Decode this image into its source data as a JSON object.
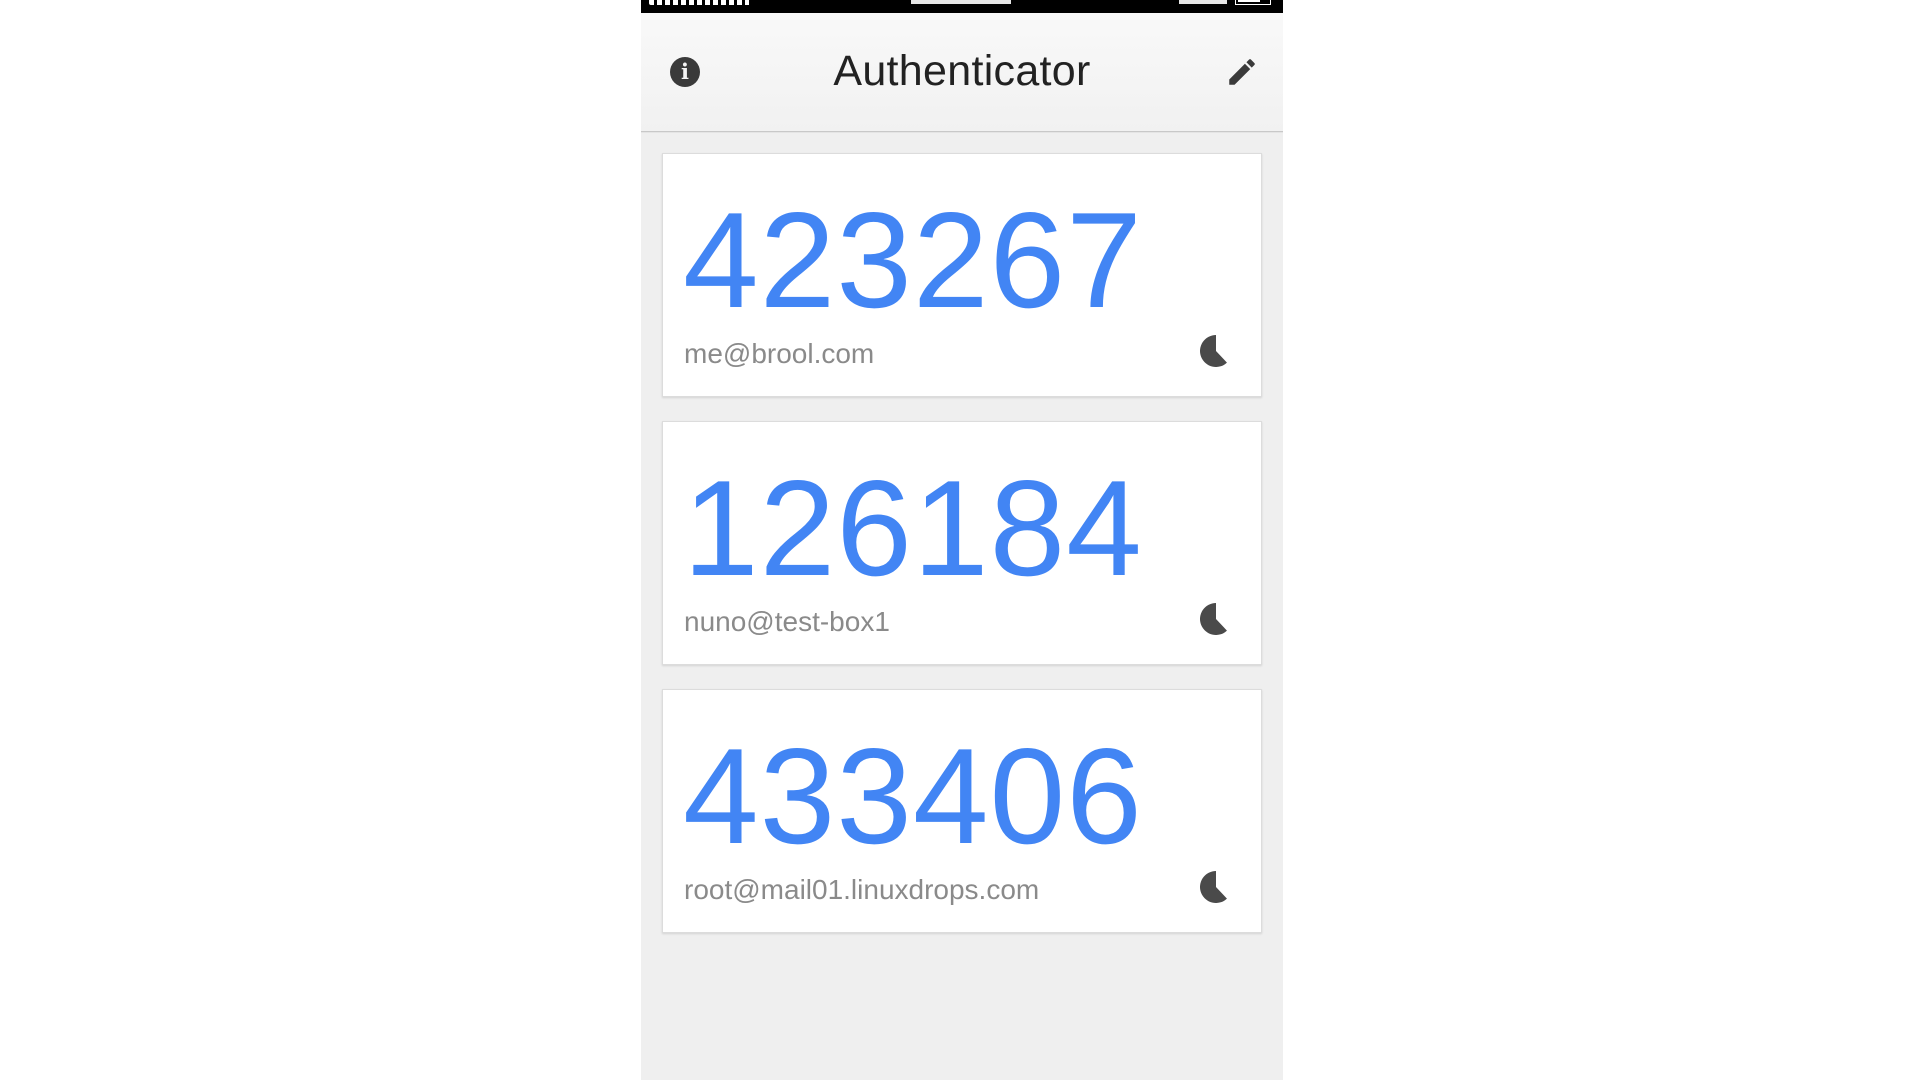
{
  "app": {
    "title": "Authenticator"
  },
  "header": {
    "info_icon": "info-icon",
    "info_glyph": "i",
    "edit_icon": "pencil-icon"
  },
  "accounts": [
    {
      "code": "423267",
      "account": "me@brool.com",
      "timer_remaining_fraction": 0.62
    },
    {
      "code": "126184",
      "account": "nuno@test-box1",
      "timer_remaining_fraction": 0.62
    },
    {
      "code": "433406",
      "account": "root@mail01.linuxdrops.com",
      "timer_remaining_fraction": 0.62
    }
  ],
  "colors": {
    "code": "#4285f4",
    "account": "#8a8a8a",
    "timer": "#4a4a4a",
    "background": "#efefef"
  }
}
